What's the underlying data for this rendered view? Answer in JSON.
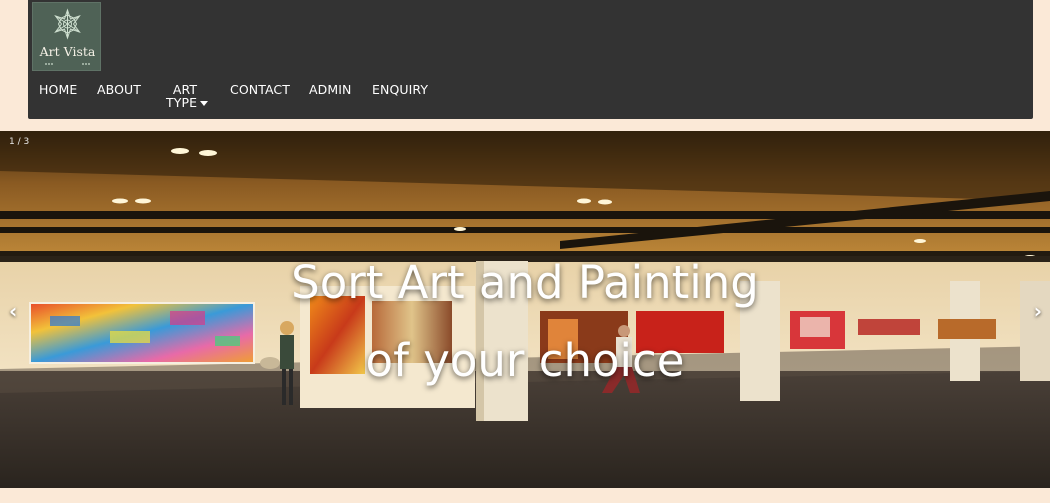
{
  "brand": {
    "logo_text": "Art Vista"
  },
  "nav": {
    "items": [
      {
        "label": "HOME"
      },
      {
        "label": "ABOUT"
      },
      {
        "label_line1": "ART",
        "label_line2": "TYPE"
      },
      {
        "label": "CONTACT"
      },
      {
        "label": "ADMIN"
      },
      {
        "label": "ENQUIRY"
      }
    ]
  },
  "slideshow": {
    "counter": "1 / 3",
    "caption_line1": "Sort Art and Painting",
    "caption_line2": "of your choice",
    "prev_symbol": "‹",
    "next_symbol": "›",
    "slide_count": 3,
    "active_slide": 1
  },
  "colors": {
    "page_background": "#fbe9d7",
    "navbar_background": "#333333",
    "logo_background": "#4f6256",
    "nav_text": "#ffffff"
  }
}
